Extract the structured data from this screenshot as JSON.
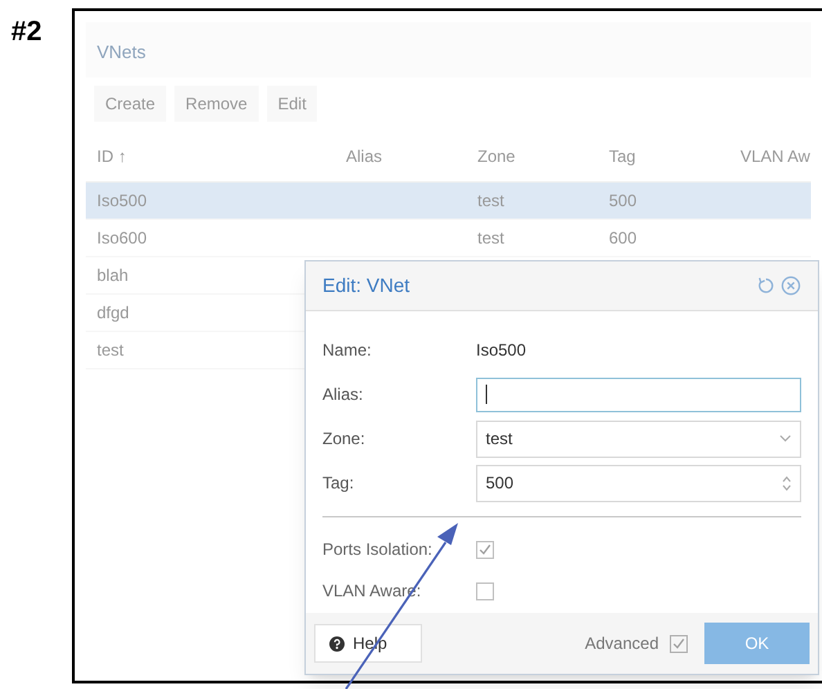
{
  "figure_label": "#2",
  "panel": {
    "title": "VNets",
    "toolbar": [
      "Create",
      "Remove",
      "Edit"
    ],
    "columns": [
      "ID ↑",
      "Alias",
      "Zone",
      "Tag",
      "VLAN Aw"
    ],
    "rows": [
      {
        "cells": [
          "Iso500",
          "",
          "test",
          "500"
        ],
        "selected": true
      },
      {
        "cells": [
          "Iso600",
          "",
          "test",
          "600"
        ],
        "selected": false
      },
      {
        "cells": [
          "blah"
        ],
        "selected": false
      },
      {
        "cells": [
          "dfgd"
        ],
        "selected": false
      },
      {
        "cells": [
          "test"
        ],
        "selected": false
      }
    ]
  },
  "dialog": {
    "title": "Edit: VNet",
    "fields": [
      {
        "kind": "text",
        "label": "Name:",
        "value": "Iso500"
      },
      {
        "kind": "input",
        "label": "Alias:",
        "focused": true
      },
      {
        "kind": "select",
        "label": "Zone:",
        "value": "test"
      },
      {
        "kind": "spinner",
        "label": "Tag:",
        "value": "500"
      }
    ],
    "checks": [
      {
        "label": "Ports Isolation:",
        "checked": true
      },
      {
        "label": "VLAN Aware:",
        "checked": false
      }
    ],
    "help_button": "Help",
    "advanced": {
      "label": "Advanced",
      "checked": true
    },
    "ok_button": "OK"
  }
}
